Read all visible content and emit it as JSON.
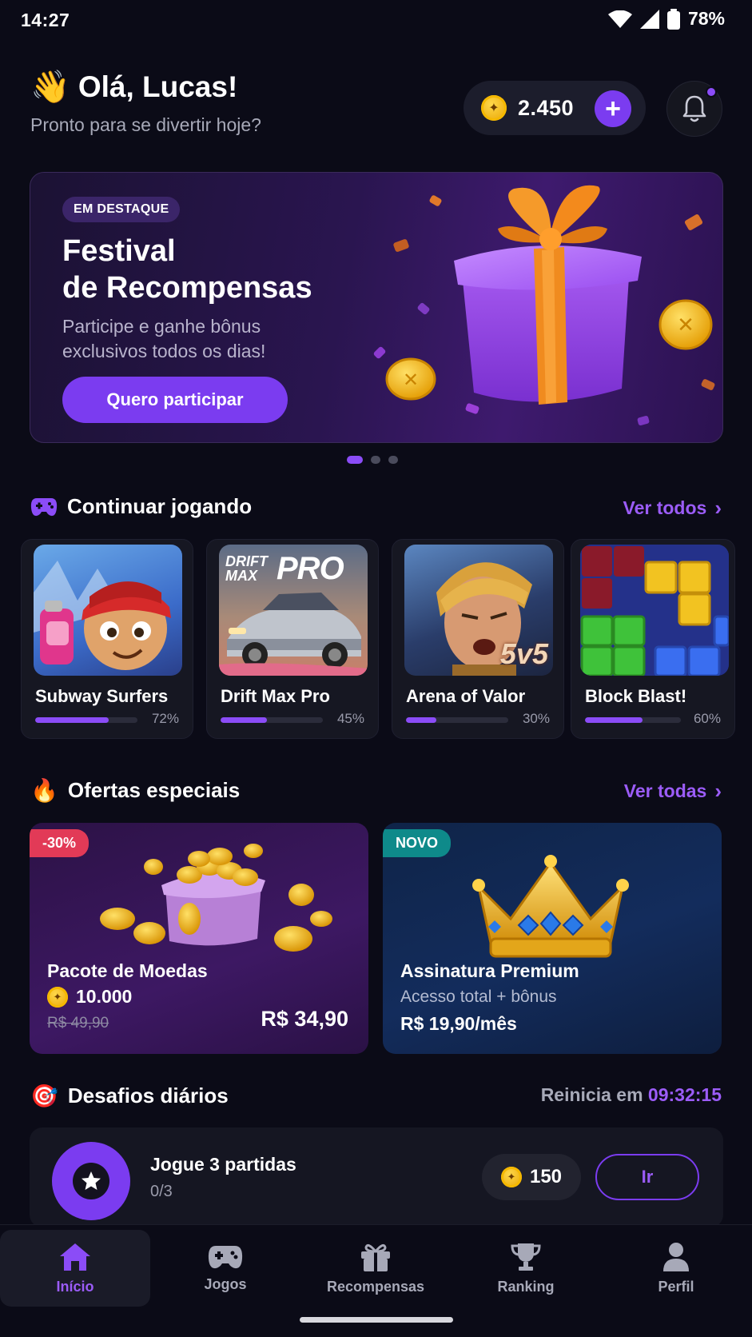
{
  "status_bar": {
    "time": "14:27",
    "battery": "78%"
  },
  "header": {
    "greeting_emoji": "👋",
    "greeting": "Olá, Lucas!",
    "subtitle": "Pronto para se divertir hoje?",
    "coins": "2.450",
    "add_label": "+",
    "notification_dot": true
  },
  "hero": {
    "badge": "EM DESTAQUE",
    "title_line1": "Festival",
    "title_line2": "de Recompensas",
    "description": "Participe e ganhe bônus exclusivos todos os dias!",
    "button": "Quero participar",
    "active_slide": 1,
    "slides": 3
  },
  "continue_playing": {
    "title": "Continuar jogando",
    "see_all": "Ver todos",
    "games": [
      {
        "name": "Subway Surfers",
        "progress": 72,
        "progress_label": "72%"
      },
      {
        "name": "Drift Max Pro",
        "progress": 45,
        "progress_label": "45%"
      },
      {
        "name": "Arena of Valor",
        "progress": 30,
        "progress_label": "30%"
      },
      {
        "name": "Block Blast!",
        "progress": 60,
        "progress_label": "60%"
      }
    ],
    "drift_logo_top": "DRIFT",
    "drift_logo_mid": "MAX",
    "drift_logo_pro": "PRO",
    "arena_logo": "5v5"
  },
  "special_offers": {
    "title": "Ofertas especiais",
    "see_all": "Ver todas",
    "offers": [
      {
        "badge": "-30%",
        "title": "Pacote de Moedas",
        "amount": "10.000",
        "old_price": "R$ 49,90",
        "price": "R$ 34,90"
      },
      {
        "badge": "NOVO",
        "title": "Assinatura Premium",
        "subtitle": "Acesso total + bônus",
        "price": "R$ 19,90/mês"
      }
    ]
  },
  "daily_challenges": {
    "title": "Desafios diários",
    "reset_prefix": "Reinicia em",
    "reset_time": "09:32:15",
    "challenge": {
      "title": "Jogue 3 partidas",
      "progress": "0/3",
      "reward": "150",
      "button": "Ir"
    }
  },
  "nav": {
    "items": [
      {
        "label": "Início",
        "icon": "home-icon",
        "active": true
      },
      {
        "label": "Jogos",
        "icon": "gamepad-icon"
      },
      {
        "label": "Recompensas",
        "icon": "gift-icon"
      },
      {
        "label": "Ranking",
        "icon": "trophy-icon"
      },
      {
        "label": "Perfil",
        "icon": "profile-icon"
      }
    ]
  },
  "colors": {
    "accent": "#7b3cf0",
    "accent_light": "#9b5cf8",
    "background": "#0b0b17",
    "coin": "#f5b800",
    "sale_badge": "#e23a57",
    "new_badge": "#0e8a8a"
  }
}
